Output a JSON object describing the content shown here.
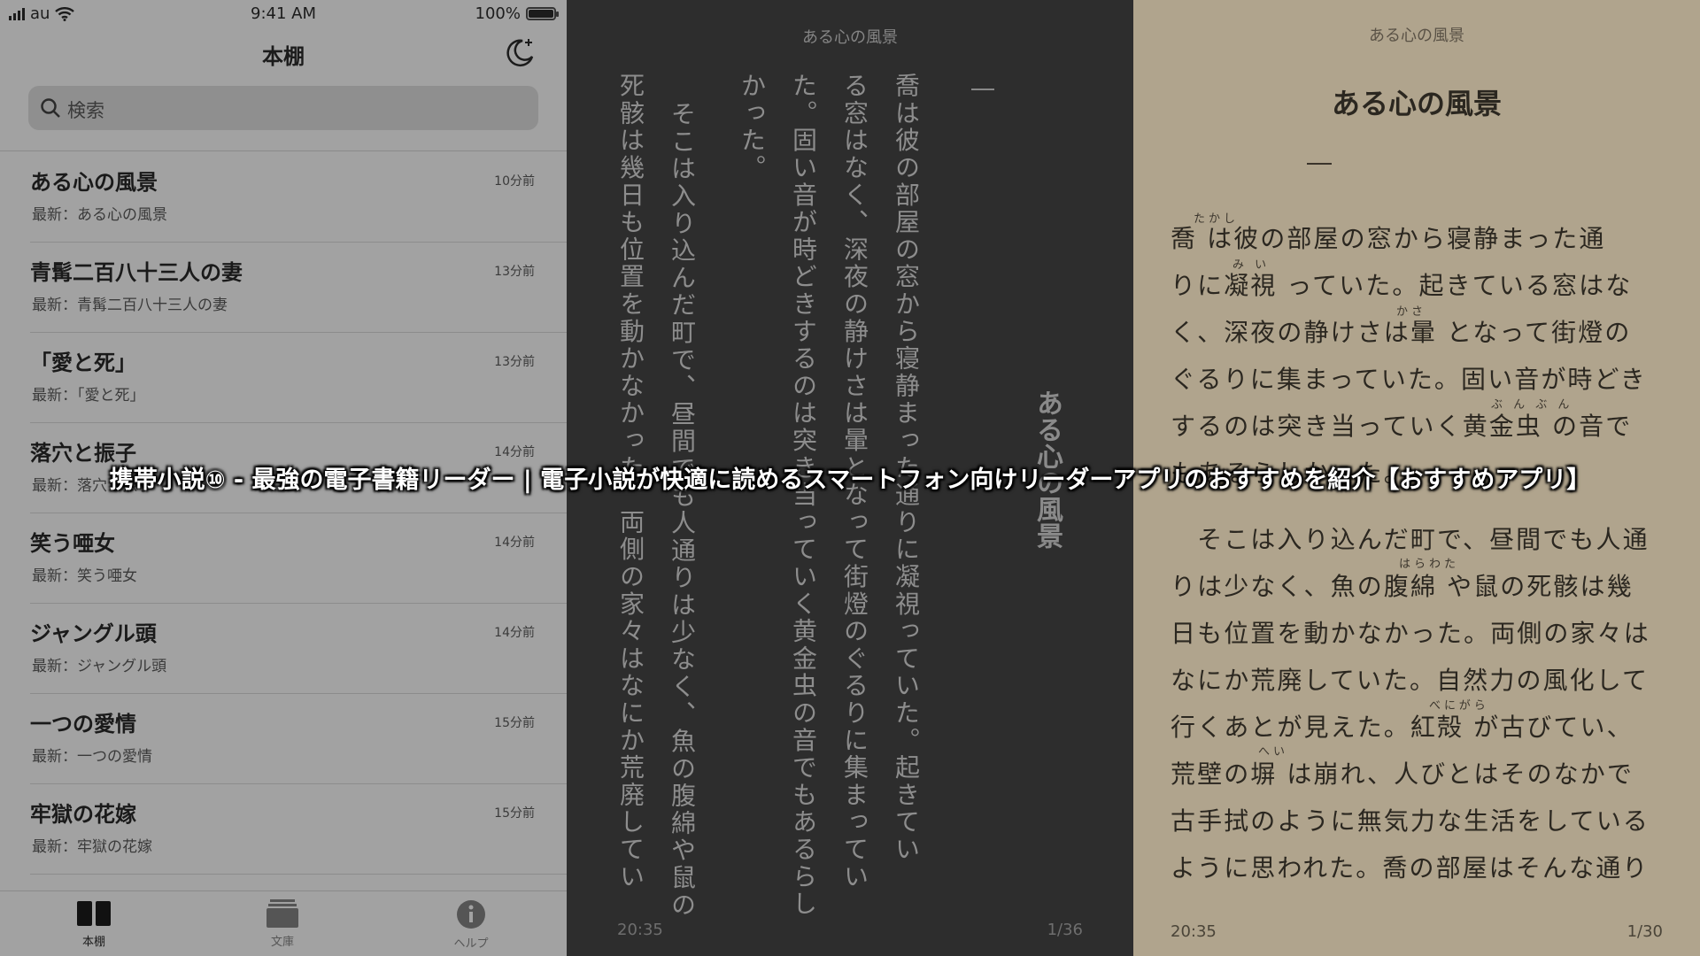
{
  "status_bar": {
    "carrier": "au",
    "time": "9:41 AM",
    "battery": "100%"
  },
  "shelf": {
    "title": "本棚",
    "search_placeholder": "検索",
    "books": [
      {
        "title": "ある心の風景",
        "latest": "最新：ある心の風景",
        "time": "10分前"
      },
      {
        "title": "青髯二百八十三人の妻",
        "latest": "最新：青髯二百八十三人の妻",
        "time": "13分前"
      },
      {
        "title": "「愛と死」",
        "latest": "最新：「愛と死」",
        "time": "13分前"
      },
      {
        "title": "落穴と振子",
        "latest": "最新：落穴と振子",
        "time": "14分前"
      },
      {
        "title": "笑う唖女",
        "latest": "最新：笑う唖女",
        "time": "14分前"
      },
      {
        "title": "ジャングル頭",
        "latest": "最新：ジャングル頭",
        "time": "14分前"
      },
      {
        "title": "一つの愛情",
        "latest": "最新：一つの愛情",
        "time": "15分前"
      },
      {
        "title": "牢獄の花嫁",
        "latest": "最新：牢獄の花嫁",
        "time": "15分前"
      }
    ],
    "tabs": [
      {
        "label": "本棚",
        "icon": "book-icon"
      },
      {
        "label": "文庫",
        "icon": "library-icon"
      },
      {
        "label": "ヘルプ",
        "icon": "info-icon"
      }
    ]
  },
  "dark_reader": {
    "header": "ある心の風景",
    "title": "ある心の風景",
    "chapter_mark": "一",
    "columns": [
      "喬は彼の部屋の窓から寝静まった通りに凝視っていた。起きてい",
      "る窓はなく、深夜の静けさは暈となって街燈のぐるりに集まってい",
      "た。固い音が時どきするのは突き当っていく黄金虫の音でもあるらし",
      "かった。",
      "そこは入り込んだ町で、昼間でも人通りは少なく、魚の腹綿や鼠の",
      "死骸は幾日も位置を動かなかった。両側の家々はなにか荒廃してい"
    ],
    "time": "20:35",
    "page": "1/36"
  },
  "sepia_reader": {
    "header": "ある心の風景",
    "title": "ある心の風景",
    "chapter_mark": "一",
    "lines": [
      "喬 は彼の部屋の窓から寝静まった通",
      "りに凝視 っていた。起きている窓はな",
      "く、深夜の静けさは暈 となって街燈の",
      "ぐるりに集まっていた。固い音が時どき",
      "するのは突き当っていく黄金虫 の音で",
      "もあるらしかった。",
      "　そこは入り込んだ町で、昼間でも人通",
      "りは少なく、魚の腹綿 や鼠の死骸は幾",
      "日も位置を動かなかった。両側の家々は",
      "なにか荒廃していた。自然力の風化して",
      "行くあとが見えた。紅殻 が古びてい、",
      "荒壁の塀 は崩れ、人びとはそのなかで",
      "古手拭のように無気力な生活をしている",
      "ように思われた。喬の部屋はそんな通り"
    ],
    "rubies": [
      "たかし",
      "み い",
      "かさ",
      "ぶ ん ぶ ん",
      "はらわた",
      "べにがら",
      "へい"
    ],
    "time": "20:35",
    "page": "1/30"
  },
  "caption": "携帯小説⑩ - 最強の電子書籍リーダー | 電子小説が快適に読めるスマートフォン向けリーダーアプリのおすすめを紹介【おすすめアプリ】"
}
